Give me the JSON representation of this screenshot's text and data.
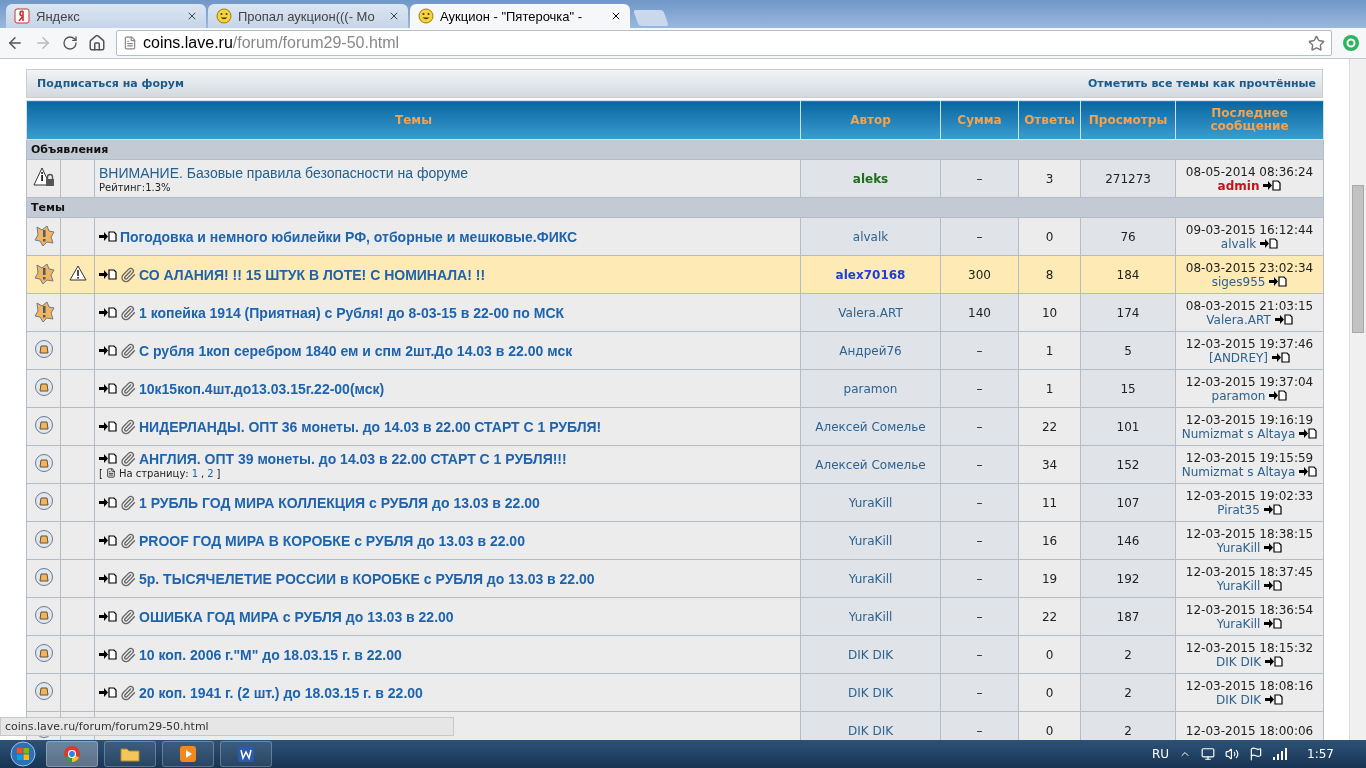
{
  "browser": {
    "tabs": [
      {
        "title": "Яндекс",
        "selected": false
      },
      {
        "title": "Пропал аукцион(((- Мо",
        "selected": false
      },
      {
        "title": "Аукцион - \"Пятерочка\" -",
        "selected": true
      }
    ],
    "address": {
      "host": "coins.lave.ru",
      "path": "/forum/forum29-50.html"
    }
  },
  "forum": {
    "subscribe_link": "Подписаться на форум",
    "mark_read_link": "Отметить все темы как прочтённые",
    "columns": [
      "Темы",
      "Автор",
      "Сумма",
      "Ответы",
      "Просмотры",
      "Последнее сообщение"
    ],
    "sections": [
      {
        "title": "Объявления",
        "rows": [
          {
            "kind": "announcement",
            "title": "ВНИМАНИЕ. Базовые правила безопасности на форуме",
            "rating": "Рейтинг:1.3%",
            "author": {
              "name": "aleks",
              "color": "#1e6e1e"
            },
            "sum": "–",
            "replies": "3",
            "views": "271273",
            "last_date": "08-05-2014 08:36:24",
            "last_user": {
              "name": "admin",
              "color": "#c0141c"
            }
          }
        ]
      },
      {
        "title": "Темы",
        "rows": [
          {
            "kind": "hot",
            "title": "Погодовка и немного юбилейки РФ, отборные и мешковые.ФИКС",
            "attachment": false,
            "author": {
              "name": "alvalk"
            },
            "sum": "–",
            "replies": "0",
            "views": "76",
            "last_date": "09-03-2015 16:12:44",
            "last_user": {
              "name": "alvalk"
            }
          },
          {
            "kind": "hot",
            "warning": true,
            "highlighted": true,
            "title": "СО АЛАНИЯ! !! 15 ШТУК В ЛОТЕ! С НОМИНАЛА! !!",
            "attachment": true,
            "author": {
              "name": "alex70168",
              "color": "#1a3ee0"
            },
            "sum": "300",
            "replies": "8",
            "views": "184",
            "last_date": "08-03-2015 23:02:34",
            "last_user": {
              "name": "siges955"
            }
          },
          {
            "kind": "hot",
            "title": "1 копейка 1914 (Приятная) с Рубля! до 8-03-15 в 22-00 по МСК",
            "attachment": true,
            "author": {
              "name": "Valera.ART"
            },
            "sum": "140",
            "replies": "10",
            "views": "174",
            "last_date": "08-03-2015 21:03:15",
            "last_user": {
              "name": "Valera.ART"
            }
          },
          {
            "kind": "normal",
            "title": "С рубля 1коп серебром 1840 ем и спм 2шт.До 14.03 в 22.00 мск",
            "attachment": true,
            "author": {
              "name": "Андрей76"
            },
            "sum": "–",
            "replies": "1",
            "views": "5",
            "last_date": "12-03-2015 19:37:46",
            "last_user": {
              "name": "[ANDREY]"
            }
          },
          {
            "kind": "normal",
            "title": "10к15коп.4шт.до13.03.15г.22-00(мск)",
            "attachment": true,
            "author": {
              "name": "paramon"
            },
            "sum": "–",
            "replies": "1",
            "views": "15",
            "last_date": "12-03-2015 19:37:04",
            "last_user": {
              "name": "paramon"
            }
          },
          {
            "kind": "normal",
            "title": "НИДЕРЛАНДЫ. ОПТ 36 монеты. до 14.03 в 22.00 СТАРТ С 1 РУБЛЯ!",
            "attachment": true,
            "author": {
              "name": "Алексей Сомелье"
            },
            "sum": "–",
            "replies": "22",
            "views": "101",
            "last_date": "12-03-2015 19:16:19",
            "last_user": {
              "name": "Numizmat s Altaya"
            }
          },
          {
            "kind": "normal",
            "title": "АНГЛИЯ. ОПТ 39 монеты. до 14.03 в 22.00 СТАРТ С 1 РУБЛЯ!!!",
            "attachment": true,
            "pages": {
              "open": "[",
              "label": "На страницу:",
              "links": [
                "1",
                "2"
              ],
              "separator": ",",
              "close": "]"
            },
            "author": {
              "name": "Алексей Сомелье"
            },
            "sum": "–",
            "replies": "34",
            "views": "152",
            "last_date": "12-03-2015 19:15:59",
            "last_user": {
              "name": "Numizmat s Altaya"
            }
          },
          {
            "kind": "normal",
            "title": "1 РУБЛЬ ГОД МИРА КОЛЛЕКЦИЯ с РУБЛЯ до 13.03 в 22.00",
            "attachment": true,
            "author": {
              "name": "YuraKill"
            },
            "sum": "–",
            "replies": "11",
            "views": "107",
            "last_date": "12-03-2015 19:02:33",
            "last_user": {
              "name": "Pirat35"
            }
          },
          {
            "kind": "normal",
            "title": "PROOF ГОД МИРА В КОРОБКЕ с РУБЛЯ до 13.03 в 22.00",
            "attachment": true,
            "author": {
              "name": "YuraKill"
            },
            "sum": "–",
            "replies": "16",
            "views": "146",
            "last_date": "12-03-2015 18:38:15",
            "last_user": {
              "name": "YuraKill"
            }
          },
          {
            "kind": "normal",
            "title": "5р. ТЫСЯЧЕЛЕТИЕ РОССИИ в КОРОБКЕ с РУБЛЯ до 13.03 в 22.00",
            "attachment": true,
            "author": {
              "name": "YuraKill"
            },
            "sum": "–",
            "replies": "19",
            "views": "192",
            "last_date": "12-03-2015 18:37:45",
            "last_user": {
              "name": "YuraKill"
            }
          },
          {
            "kind": "normal",
            "title": "ОШИБКА ГОД МИРА с РУБЛЯ до 13.03 в 22.00",
            "attachment": true,
            "author": {
              "name": "YuraKill"
            },
            "sum": "–",
            "replies": "22",
            "views": "187",
            "last_date": "12-03-2015 18:36:54",
            "last_user": {
              "name": "YuraKill"
            }
          },
          {
            "kind": "normal",
            "title": "10 коп. 2006 г.\"М\" до 18.03.15 г. в 22.00",
            "attachment": true,
            "author": {
              "name": "DIK DIK"
            },
            "sum": "–",
            "replies": "0",
            "views": "2",
            "last_date": "12-03-2015 18:15:32",
            "last_user": {
              "name": "DIK DIK"
            }
          },
          {
            "kind": "normal",
            "title": "20 коп. 1941 г. (2 шт.) до 18.03.15 г. в 22.00",
            "attachment": true,
            "author": {
              "name": "DIK DIK"
            },
            "sum": "–",
            "replies": "0",
            "views": "2",
            "last_date": "12-03-2015 18:08:16",
            "last_user": {
              "name": "DIK DIK"
            }
          },
          {
            "kind": "normal",
            "author": {
              "name": "DIK DIK"
            },
            "sum": "–",
            "replies": "0",
            "views": "2",
            "last_date": "12-03-2015 18:00:06"
          }
        ]
      }
    ]
  },
  "status_url": "coins.lave.ru/forum/forum29-50.html",
  "taskbar": {
    "apps": [
      {
        "kind": "chrome",
        "selected": true
      },
      {
        "kind": "explorer",
        "selected": false
      },
      {
        "kind": "media",
        "selected": false
      },
      {
        "kind": "word",
        "selected": false
      }
    ],
    "language": "RU",
    "clock": "1:57"
  }
}
